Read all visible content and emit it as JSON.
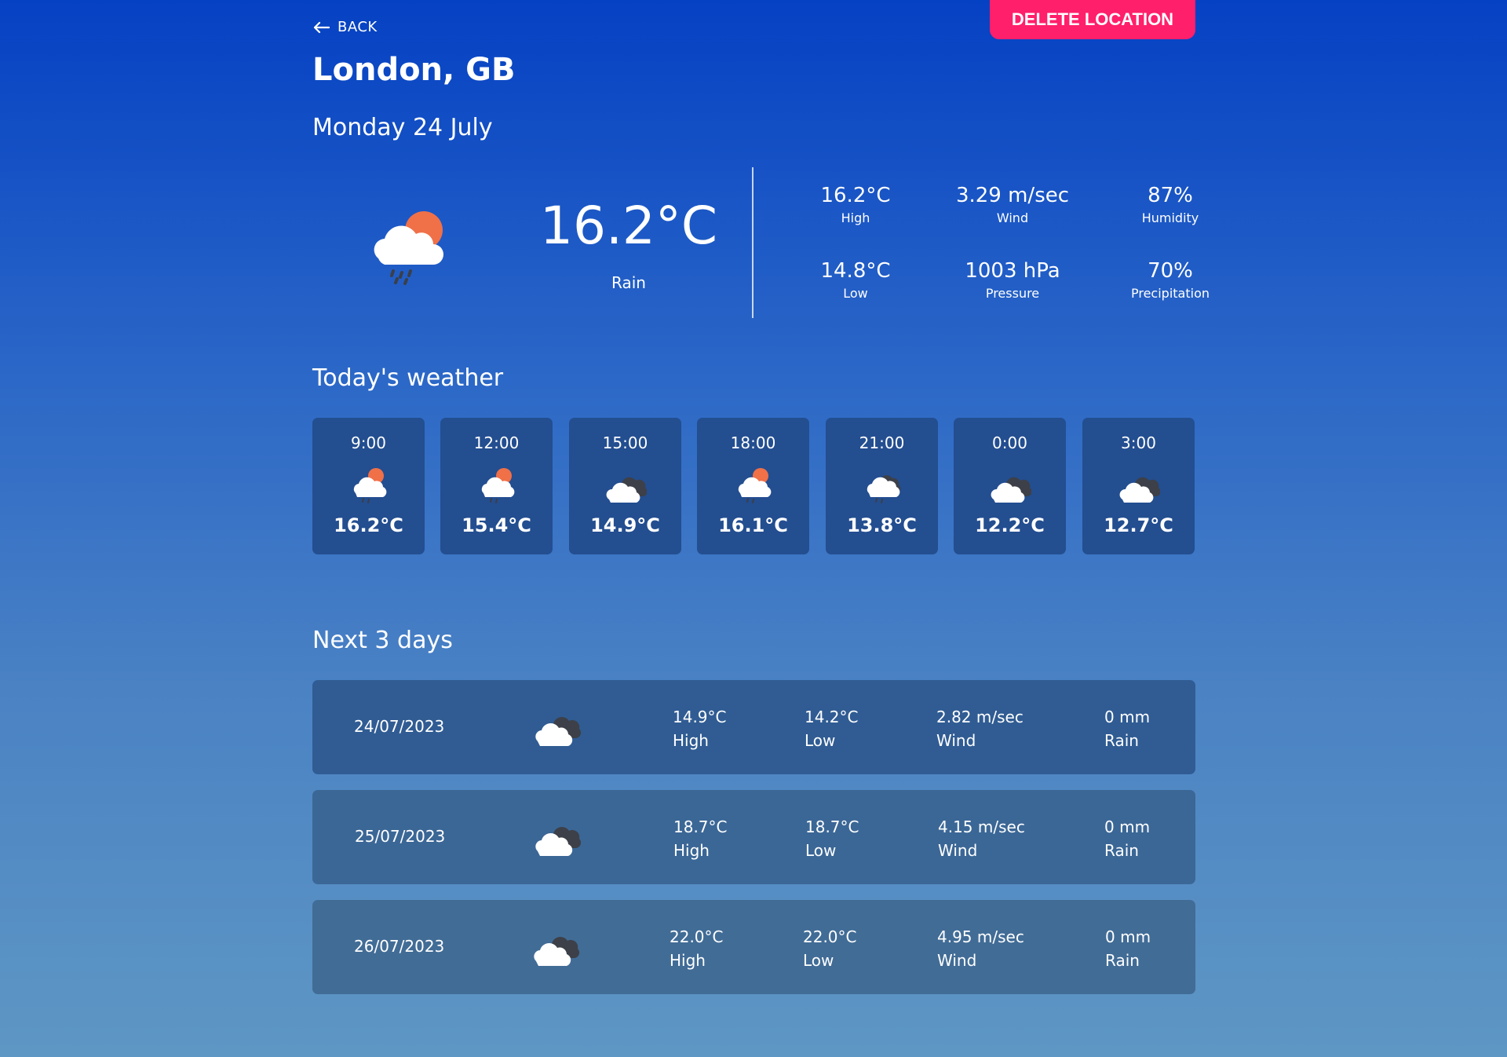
{
  "header": {
    "back_label": "BACK",
    "delete_label": "DELETE LOCATION",
    "location": "London, GB",
    "date": "Monday 24 July"
  },
  "current": {
    "icon": "cloud-sun-rain-icon",
    "temperature": "16.2°C",
    "condition": "Rain",
    "stats": [
      {
        "value": "16.2°C",
        "label": "High"
      },
      {
        "value": "3.29 m/sec",
        "label": "Wind"
      },
      {
        "value": "87%",
        "label": "Humidity"
      },
      {
        "value": "14.8°C",
        "label": "Low"
      },
      {
        "value": "1003 hPa",
        "label": "Pressure"
      },
      {
        "value": "70%",
        "label": "Precipitation"
      }
    ]
  },
  "today": {
    "title": "Today's weather",
    "hours": [
      {
        "time": "9:00",
        "temp": "16.2°C",
        "icon": "cloud-sun-rain-icon"
      },
      {
        "time": "12:00",
        "temp": "15.4°C",
        "icon": "cloud-sun-rain-icon"
      },
      {
        "time": "15:00",
        "temp": "14.9°C",
        "icon": "clouds-icon"
      },
      {
        "time": "18:00",
        "temp": "16.1°C",
        "icon": "cloud-sun-rain-icon"
      },
      {
        "time": "21:00",
        "temp": "13.8°C",
        "icon": "cloud-rain-icon"
      },
      {
        "time": "0:00",
        "temp": "12.2°C",
        "icon": "clouds-icon"
      },
      {
        "time": "3:00",
        "temp": "12.7°C",
        "icon": "clouds-icon"
      }
    ]
  },
  "forecast": {
    "title": "Next 3 days",
    "days": [
      {
        "date": "24/07/2023",
        "icon": "clouds-icon",
        "high": "14.9°C",
        "high_label": "High",
        "low": "14.2°C",
        "low_label": "Low",
        "wind": "2.82 m/sec",
        "wind_label": "Wind",
        "rain": "0 mm",
        "rain_label": "Rain"
      },
      {
        "date": "25/07/2023",
        "icon": "clouds-icon",
        "high": "18.7°C",
        "high_label": "High",
        "low": "18.7°C",
        "low_label": "Low",
        "wind": "4.15 m/sec",
        "wind_label": "Wind",
        "rain": "0 mm",
        "rain_label": "Rain"
      },
      {
        "date": "26/07/2023",
        "icon": "clouds-icon",
        "high": "22.0°C",
        "high_label": "High",
        "low": "22.0°C",
        "low_label": "Low",
        "wind": "4.95 m/sec",
        "wind_label": "Wind",
        "rain": "0 mm",
        "rain_label": "Rain"
      }
    ]
  },
  "colors": {
    "delete_button": "#ff1f6b",
    "card_bg": "#234e90",
    "sun": "#f07048"
  }
}
